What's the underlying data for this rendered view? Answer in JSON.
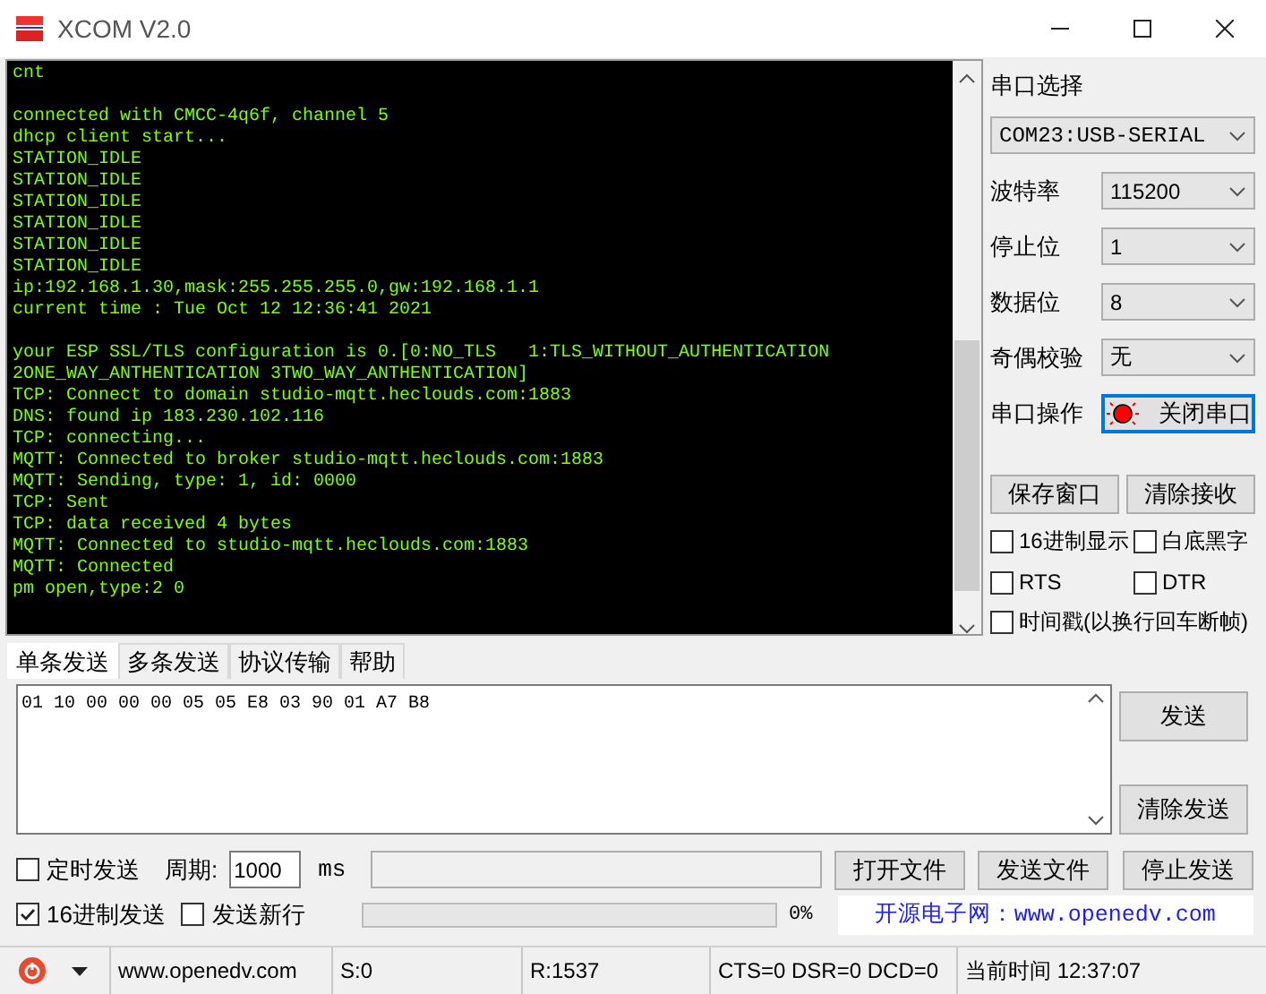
{
  "window": {
    "title": "XCOM V2.0"
  },
  "terminal": {
    "blocks": [
      [
        "cnt"
      ],
      [
        "connected with CMCC-4q6f, channel 5",
        "dhcp client start...",
        "STATION_IDLE",
        "STATION_IDLE",
        "STATION_IDLE",
        "STATION_IDLE",
        "STATION_IDLE",
        "STATION_IDLE",
        "ip:192.168.1.30,mask:255.255.255.0,gw:192.168.1.1",
        "current time : Tue Oct 12 12:36:41 2021"
      ],
      [
        "your ESP SSL/TLS configuration is 0.[0:NO_TLS   1:TLS_WITHOUT_AUTHENTICATION",
        "2ONE_WAY_ANTHENTICATION 3TWO_WAY_ANTHENTICATION]",
        "TCP: Connect to domain studio-mqtt.heclouds.com:1883",
        "DNS: found ip 183.230.102.116",
        "TCP: connecting...",
        "MQTT: Connected to broker studio-mqtt.heclouds.com:1883",
        "MQTT: Sending, type: 1, id: 0000",
        "TCP: Sent",
        "TCP: data received 4 bytes",
        "MQTT: Connected to studio-mqtt.heclouds.com:1883",
        "MQTT: Connected",
        "pm open,type:2 0"
      ]
    ]
  },
  "serial_panel": {
    "port_label": "串口选择",
    "port": "COM23:USB-SERIAL",
    "settings": [
      {
        "label": "波特率",
        "value": "115200"
      },
      {
        "label": "停止位",
        "value": "1"
      },
      {
        "label": "数据位",
        "value": "8"
      },
      {
        "label": "奇偶校验",
        "value": "无"
      }
    ],
    "operation": {
      "label": "串口操作",
      "button": "关闭串口",
      "open": true
    },
    "buttons": [
      "保存窗口",
      "清除接收"
    ],
    "options": [
      {
        "label": "16进制显示",
        "checked": false
      },
      {
        "label": "白底黑字",
        "checked": false
      },
      {
        "label": "RTS",
        "checked": false
      },
      {
        "label": "DTR",
        "checked": false
      },
      {
        "label": "时间戳(以换行回车断帧)",
        "checked": false
      }
    ]
  },
  "send": {
    "tabs": [
      {
        "label": "单条发送",
        "selected": true
      },
      {
        "label": "多条发送",
        "selected": false
      },
      {
        "label": "协议传输",
        "selected": false
      },
      {
        "label": "帮助",
        "selected": false
      }
    ],
    "input": "01 10 00 00 00 05 05 E8 03 90 01 A7 B8",
    "buttons": [
      "发送",
      "清除发送"
    ],
    "timed": {
      "label": "定时发送",
      "checked": false
    },
    "period_label": "周期:",
    "period": "1000",
    "unit": "ms",
    "file_buttons": [
      "打开文件",
      "发送文件",
      "停止发送"
    ],
    "hex_send": {
      "label": "16进制发送",
      "checked": true
    },
    "newline": {
      "label": "发送新行",
      "checked": false
    },
    "progress": {
      "level": 0
    },
    "percent": "0%",
    "banner": "开源电子网：www.openedv.com"
  },
  "status_bar": {
    "website": "www.openedv.com",
    "sent": "S:0",
    "received": "R:1537",
    "lines": "CTS=0 DSR=0 DCD=0",
    "time": "当前时间 12:37:07"
  }
}
